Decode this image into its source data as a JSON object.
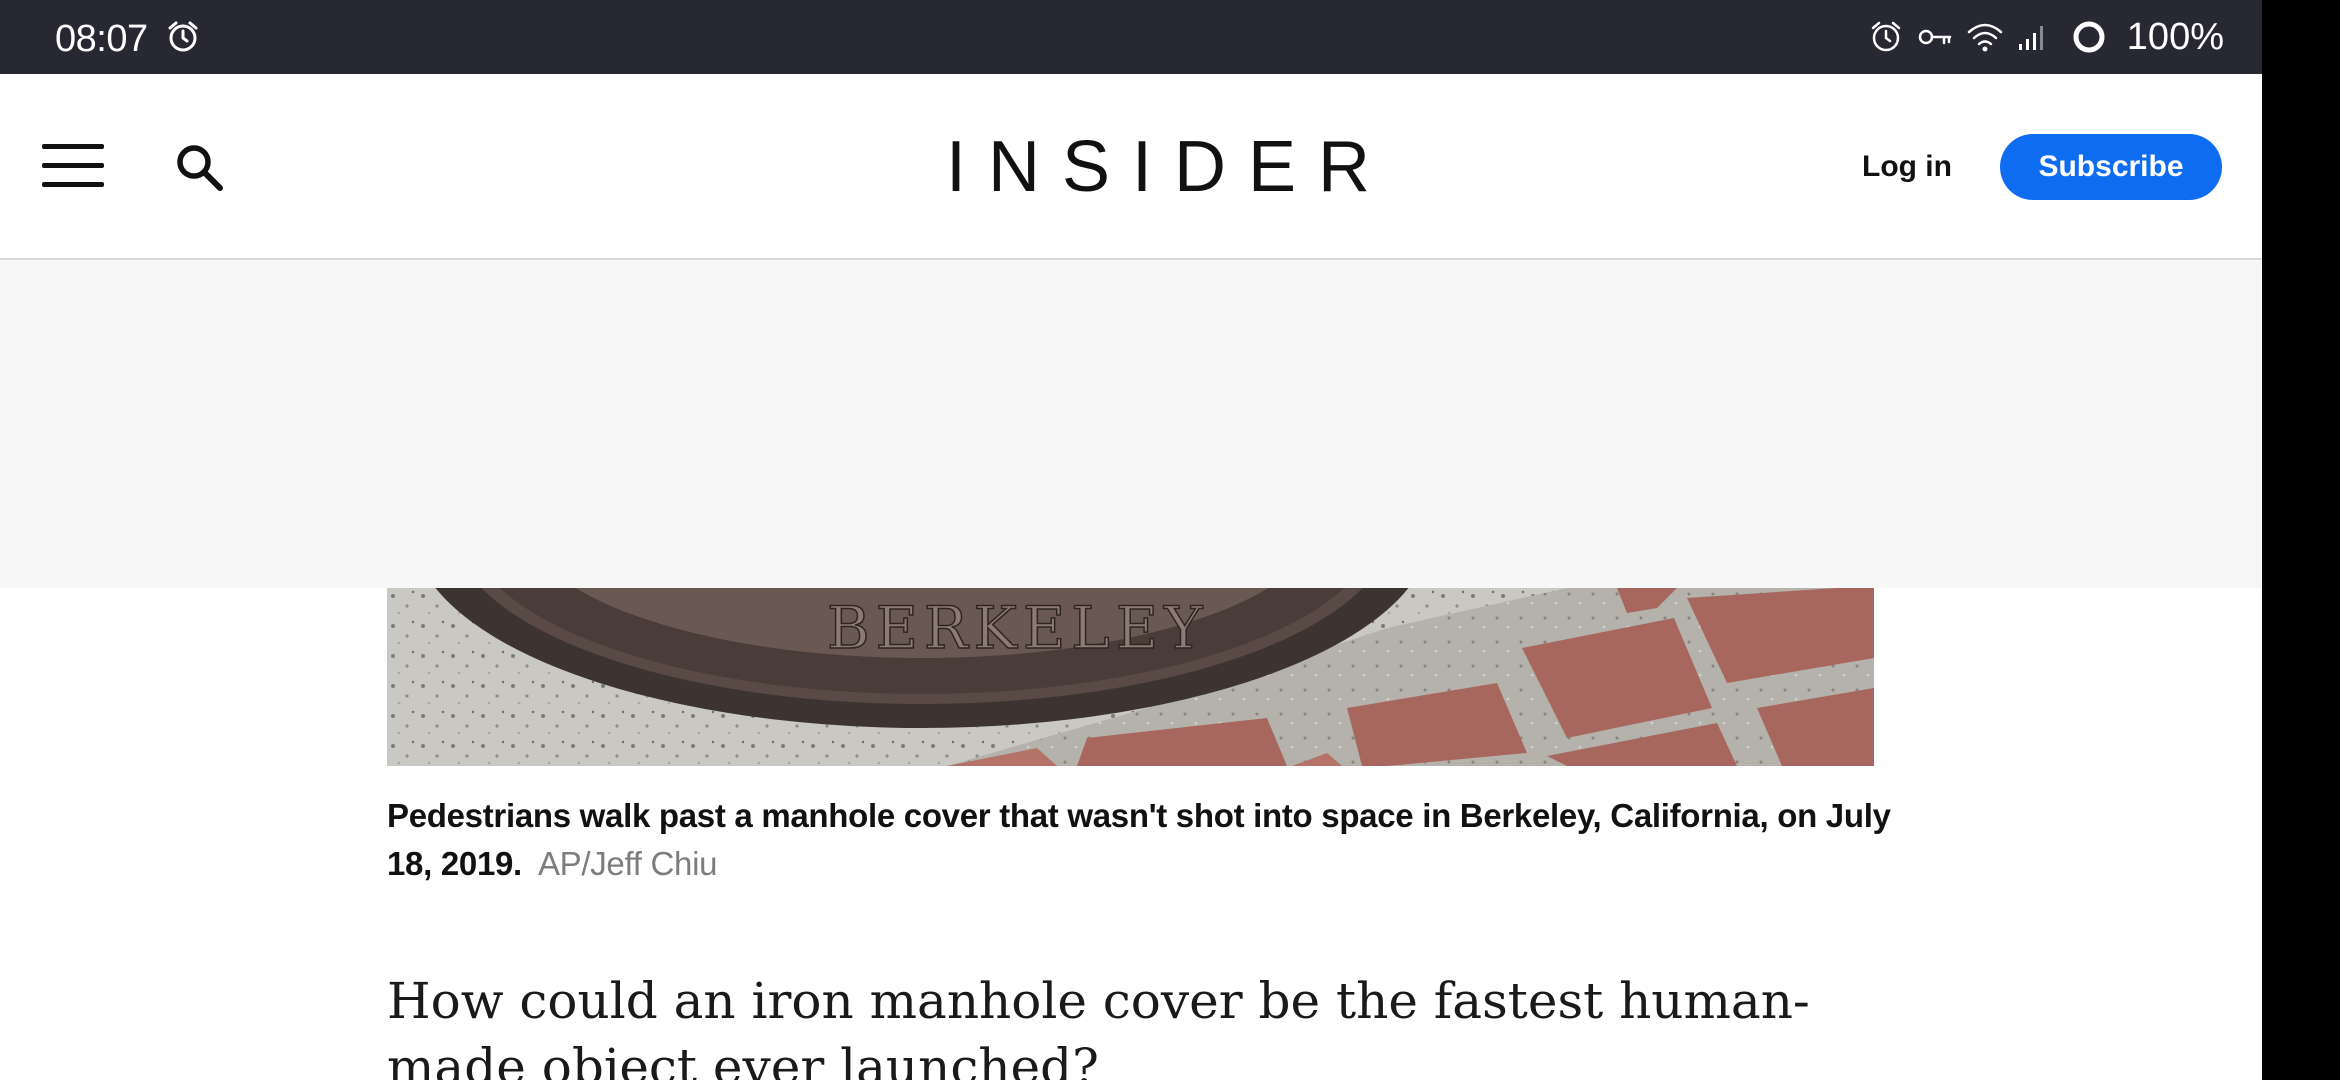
{
  "status_bar": {
    "time": "08:07",
    "battery": "100%",
    "icons": [
      "alarm-icon",
      "vpn-key-icon",
      "wifi-icon",
      "signal-icon",
      "battery-ring-icon"
    ]
  },
  "header": {
    "logo": "INSIDER",
    "login_label": "Log in",
    "subscribe_label": "Subscribe",
    "icons": [
      "hamburger-menu-icon",
      "search-icon"
    ]
  },
  "article": {
    "image_text": "BERKELEY",
    "caption": "Pedestrians walk past a manhole cover that wasn't shot into space in Berkeley, California, on July 18, 2019.",
    "credit": "AP/Jeff Chiu",
    "body_first_line": "How could an iron manhole cover be the fastest human-made object ever launched?"
  },
  "colors": {
    "status_bar": "#282833",
    "accent": "#0e6cf0",
    "ad_background": "#f6f7f6",
    "credit_text": "#7d7d7d"
  }
}
